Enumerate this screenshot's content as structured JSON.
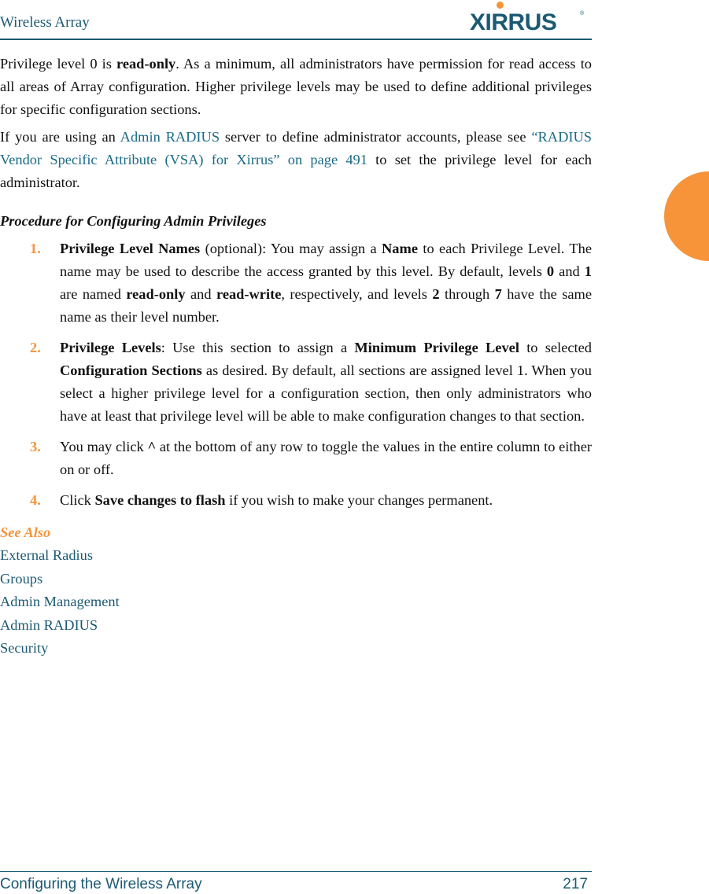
{
  "header": {
    "title": "Wireless Array",
    "logo_text": "XIRRUS",
    "logo_reg": "®"
  },
  "colors": {
    "brand": "#1b5a73",
    "accent": "#f7943a",
    "link": "#1b6b87"
  },
  "para1": {
    "t1": "Privilege level 0 is ",
    "b1": "read-only",
    "t2": ". As a minimum, all administrators have permission for read access to all areas of Array configuration. Higher privilege levels may be used to define additional privileges for specific configuration sections."
  },
  "para2": {
    "t1": "If you are using an ",
    "link1": "Admin RADIUS",
    "t2": " server to define administrator accounts, please see ",
    "link2": "“RADIUS Vendor Specific Attribute (VSA) for Xirrus” on page 491",
    "t3": " to set the privilege level for each administrator."
  },
  "procedure": {
    "heading": "Procedure for Configuring Admin Privileges",
    "steps": [
      {
        "num": "1.",
        "b1": "Privilege Level Names",
        "t1": " (optional): You may assign a ",
        "b2": "Name",
        "t2": " to each Privilege Level. The name may be used to describe the access granted by this level. By default, levels ",
        "b3": "0",
        "t3": " and ",
        "b4": "1",
        "t4": " are named ",
        "b5": "read-only",
        "t5": " and ",
        "b6": "read-write",
        "t6": ", respectively, and levels ",
        "b7": "2",
        "t7": " through ",
        "b8": "7",
        "t8": " have the same name as their level number."
      },
      {
        "num": "2.",
        "b1": "Privilege Levels",
        "t1": ": Use this section to assign a ",
        "b2": "Minimum Privilege Level",
        "t2": " to selected ",
        "b3": "Configuration Sections",
        "t3": " as desired. By default, all sections are assigned level 1. When you select a higher privilege level for a configuration section, then only administrators who have at least that privilege level will be able to make configuration changes to that section."
      },
      {
        "num": "3.",
        "t1": "You may click ",
        "b1": "^",
        "t2": " at the bottom of any row to toggle the values in the entire column to either on or off."
      },
      {
        "num": "4.",
        "t1": "Click ",
        "b1": "Save changes to flash",
        "t2": " if you wish to make your changes permanent."
      }
    ]
  },
  "see_also": {
    "heading": "See Also",
    "links": [
      "External Radius",
      "Groups",
      "Admin Management",
      "Admin RADIUS",
      "Security"
    ]
  },
  "footer": {
    "section": "Configuring the Wireless Array",
    "page": "217"
  }
}
